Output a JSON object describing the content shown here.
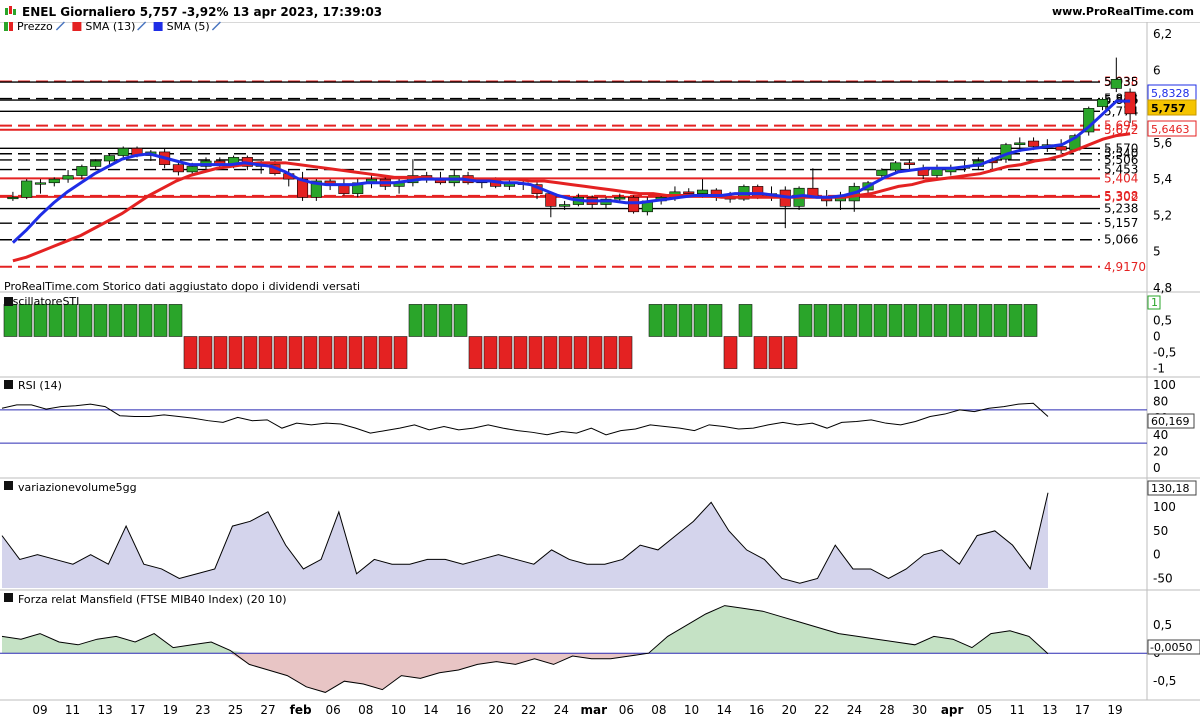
{
  "header": {
    "title": "ENEL Giornaliero 5,757 -3,92% 13 apr 2023, 17:39:03",
    "site": "www.ProRealTime.com"
  },
  "colors": {
    "up": "#2aa52a",
    "down": "#e42222",
    "sma13": "#e42222",
    "sma5": "#1e2de6",
    "level_red": "#e42222",
    "level_black": "#000000",
    "area_fill": "#d4d4ec",
    "mansfield_pos": "#c5e2c5",
    "mansfield_neg": "#e8c5c5"
  },
  "price_panel": {
    "legend": [
      {
        "icon": "price-candle-icon",
        "label": "Prezzo"
      },
      {
        "icon": "sma13-swatch-icon",
        "label": "SMA (13)"
      },
      {
        "icon": "sma5-swatch-icon",
        "label": "SMA (5)"
      }
    ],
    "note": "ProRealTime.com  Storico dati aggiustato dopo i dividendi versati",
    "y_ticks": [
      "6,2",
      "6",
      "5,8",
      "5,6",
      "5,4",
      "5,2",
      "5",
      "4,8"
    ],
    "price_tags": {
      "sma5": "5,8328",
      "last": "5,757",
      "sma13": "5,6463"
    },
    "levels": [
      {
        "value": 5.938,
        "label": "5,938",
        "color": "red",
        "style": "dashed"
      },
      {
        "value": 5.935,
        "label": "5,935",
        "color": "black",
        "style": "solid"
      },
      {
        "value": 5.844,
        "label": "5,844",
        "color": "black",
        "style": "dashed"
      },
      {
        "value": 5.836,
        "label": "5,836",
        "color": "black",
        "style": "solid"
      },
      {
        "value": 5.774,
        "label": "5,774",
        "color": "black",
        "style": "solid"
      },
      {
        "value": 5.695,
        "label": "5,695",
        "color": "red",
        "style": "dashed"
      },
      {
        "value": 5.672,
        "label": "5,672",
        "color": "red",
        "style": "solid"
      },
      {
        "value": 5.57,
        "label": "5,570",
        "color": "black",
        "style": "solid"
      },
      {
        "value": 5.54,
        "label": "5,540",
        "color": "black",
        "style": "dashed"
      },
      {
        "value": 5.506,
        "label": "5,506",
        "color": "black",
        "style": "dashed"
      },
      {
        "value": 5.453,
        "label": "5,453",
        "color": "black",
        "style": "dashed"
      },
      {
        "value": 5.404,
        "label": "5,404",
        "color": "red",
        "style": "solid"
      },
      {
        "value": 5.308,
        "label": "5,308",
        "color": "red",
        "style": "dashed"
      },
      {
        "value": 5.302,
        "label": "5,302",
        "color": "red",
        "style": "solid"
      },
      {
        "value": 5.238,
        "label": "5,238",
        "color": "black",
        "style": "solid"
      },
      {
        "value": 5.157,
        "label": "5,157",
        "color": "black",
        "style": "dashed"
      },
      {
        "value": 5.066,
        "label": "5,066",
        "color": "black",
        "style": "dashed"
      },
      {
        "value": 4.917,
        "label": "4,9170",
        "color": "red",
        "style": "dashed"
      }
    ]
  },
  "chart_data": {
    "type": "candlestick",
    "x_labels": [
      "09",
      "11",
      "13",
      "17",
      "19",
      "23",
      "25",
      "27",
      "feb",
      "06",
      "08",
      "10",
      "14",
      "16",
      "20",
      "22",
      "24",
      "mar",
      "06",
      "08",
      "10",
      "14",
      "16",
      "20",
      "22",
      "24",
      "28",
      "30",
      "apr",
      "05",
      "11",
      "13",
      "17",
      "19"
    ],
    "ylim": [
      4.8,
      6.2
    ],
    "candles": [
      [
        5.3,
        5.33,
        5.28,
        5.3
      ],
      [
        5.3,
        5.4,
        5.29,
        5.39
      ],
      [
        5.38,
        5.4,
        5.32,
        5.38
      ],
      [
        5.38,
        5.41,
        5.36,
        5.4
      ],
      [
        5.4,
        5.45,
        5.38,
        5.42
      ],
      [
        5.42,
        5.48,
        5.4,
        5.47
      ],
      [
        5.47,
        5.51,
        5.45,
        5.5
      ],
      [
        5.5,
        5.54,
        5.47,
        5.53
      ],
      [
        5.53,
        5.58,
        5.51,
        5.57
      ],
      [
        5.57,
        5.58,
        5.52,
        5.53
      ],
      [
        5.53,
        5.56,
        5.5,
        5.55
      ],
      [
        5.55,
        5.57,
        5.46,
        5.48
      ],
      [
        5.48,
        5.5,
        5.42,
        5.44
      ],
      [
        5.44,
        5.49,
        5.42,
        5.47
      ],
      [
        5.47,
        5.52,
        5.45,
        5.5
      ],
      [
        5.5,
        5.52,
        5.46,
        5.48
      ],
      [
        5.48,
        5.53,
        5.46,
        5.52
      ],
      [
        5.52,
        5.53,
        5.45,
        5.47
      ],
      [
        5.47,
        5.5,
        5.43,
        5.48
      ],
      [
        5.48,
        5.5,
        5.42,
        5.43
      ],
      [
        5.43,
        5.45,
        5.36,
        5.4
      ],
      [
        5.4,
        5.44,
        5.28,
        5.3
      ],
      [
        5.3,
        5.4,
        5.28,
        5.39
      ],
      [
        5.39,
        5.4,
        5.34,
        5.37
      ],
      [
        5.37,
        5.4,
        5.31,
        5.32
      ],
      [
        5.32,
        5.4,
        5.3,
        5.38
      ],
      [
        5.38,
        5.42,
        5.35,
        5.4
      ],
      [
        5.4,
        5.42,
        5.34,
        5.36
      ],
      [
        5.36,
        5.4,
        5.32,
        5.38
      ],
      [
        5.38,
        5.51,
        5.36,
        5.42
      ],
      [
        5.42,
        5.44,
        5.38,
        5.4
      ],
      [
        5.4,
        5.44,
        5.37,
        5.38
      ],
      [
        5.38,
        5.45,
        5.36,
        5.42
      ],
      [
        5.42,
        5.44,
        5.37,
        5.38
      ],
      [
        5.38,
        5.4,
        5.35,
        5.4
      ],
      [
        5.4,
        5.41,
        5.35,
        5.36
      ],
      [
        5.36,
        5.4,
        5.34,
        5.38
      ],
      [
        5.38,
        5.4,
        5.34,
        5.37
      ],
      [
        5.37,
        5.39,
        5.29,
        5.32
      ],
      [
        5.32,
        5.33,
        5.19,
        5.25
      ],
      [
        5.25,
        5.28,
        5.23,
        5.26
      ],
      [
        5.26,
        5.32,
        5.25,
        5.3
      ],
      [
        5.3,
        5.31,
        5.24,
        5.26
      ],
      [
        5.26,
        5.3,
        5.24,
        5.29
      ],
      [
        5.29,
        5.32,
        5.27,
        5.3
      ],
      [
        5.3,
        5.31,
        5.21,
        5.22
      ],
      [
        5.22,
        5.3,
        5.2,
        5.28
      ],
      [
        5.28,
        5.32,
        5.26,
        5.3
      ],
      [
        5.3,
        5.36,
        5.28,
        5.33
      ],
      [
        5.33,
        5.35,
        5.3,
        5.32
      ],
      [
        5.32,
        5.4,
        5.3,
        5.34
      ],
      [
        5.34,
        5.35,
        5.28,
        5.3
      ],
      [
        5.3,
        5.33,
        5.27,
        5.29
      ],
      [
        5.29,
        5.37,
        5.28,
        5.36
      ],
      [
        5.36,
        5.37,
        5.29,
        5.3
      ],
      [
        5.3,
        5.36,
        5.28,
        5.32
      ],
      [
        5.34,
        5.36,
        5.13,
        5.25
      ],
      [
        5.25,
        5.36,
        5.23,
        5.35
      ],
      [
        5.35,
        5.46,
        5.33,
        5.3
      ],
      [
        5.3,
        5.34,
        5.25,
        5.28
      ],
      [
        5.28,
        5.33,
        5.23,
        5.3
      ],
      [
        5.28,
        5.38,
        5.22,
        5.36
      ],
      [
        5.34,
        5.39,
        5.31,
        5.38
      ],
      [
        5.42,
        5.46,
        5.4,
        5.45
      ],
      [
        5.45,
        5.5,
        5.43,
        5.49
      ],
      [
        5.49,
        5.51,
        5.45,
        5.48
      ],
      [
        5.46,
        5.48,
        5.4,
        5.42
      ],
      [
        5.42,
        5.48,
        5.4,
        5.46
      ],
      [
        5.44,
        5.48,
        5.42,
        5.46
      ],
      [
        5.46,
        5.5,
        5.44,
        5.47
      ],
      [
        5.47,
        5.52,
        5.45,
        5.5
      ],
      [
        5.5,
        5.52,
        5.44,
        5.49
      ],
      [
        5.51,
        5.6,
        5.49,
        5.59
      ],
      [
        5.59,
        5.63,
        5.55,
        5.6
      ],
      [
        5.61,
        5.63,
        5.56,
        5.58
      ],
      [
        5.58,
        5.62,
        5.55,
        5.59
      ],
      [
        5.58,
        5.62,
        5.54,
        5.56
      ],
      [
        5.56,
        5.65,
        5.55,
        5.64
      ],
      [
        5.66,
        5.8,
        5.64,
        5.79
      ],
      [
        5.8,
        5.85,
        5.78,
        5.84
      ],
      [
        5.9,
        6.07,
        5.88,
        5.95
      ],
      [
        5.88,
        5.9,
        5.71,
        5.76
      ]
    ],
    "sma13": [
      4.95,
      4.97,
      5.0,
      5.03,
      5.06,
      5.09,
      5.13,
      5.17,
      5.21,
      5.26,
      5.31,
      5.35,
      5.39,
      5.42,
      5.44,
      5.46,
      5.47,
      5.48,
      5.49,
      5.49,
      5.49,
      5.48,
      5.47,
      5.46,
      5.45,
      5.44,
      5.43,
      5.42,
      5.41,
      5.41,
      5.41,
      5.4,
      5.4,
      5.4,
      5.4,
      5.4,
      5.4,
      5.4,
      5.39,
      5.39,
      5.38,
      5.37,
      5.36,
      5.35,
      5.34,
      5.33,
      5.32,
      5.32,
      5.31,
      5.31,
      5.31,
      5.31,
      5.3,
      5.3,
      5.3,
      5.3,
      5.3,
      5.3,
      5.3,
      5.3,
      5.3,
      5.3,
      5.31,
      5.32,
      5.34,
      5.36,
      5.37,
      5.39,
      5.4,
      5.41,
      5.42,
      5.43,
      5.45,
      5.47,
      5.48,
      5.5,
      5.51,
      5.53,
      5.56,
      5.59,
      5.62,
      5.64,
      5.65
    ],
    "sma5": [
      5.05,
      5.12,
      5.2,
      5.27,
      5.33,
      5.38,
      5.43,
      5.47,
      5.51,
      5.53,
      5.54,
      5.52,
      5.5,
      5.48,
      5.48,
      5.48,
      5.48,
      5.49,
      5.48,
      5.47,
      5.44,
      5.4,
      5.38,
      5.37,
      5.37,
      5.37,
      5.38,
      5.38,
      5.38,
      5.39,
      5.4,
      5.4,
      5.4,
      5.4,
      5.39,
      5.39,
      5.38,
      5.38,
      5.37,
      5.34,
      5.31,
      5.29,
      5.28,
      5.28,
      5.28,
      5.27,
      5.27,
      5.28,
      5.29,
      5.3,
      5.31,
      5.31,
      5.31,
      5.32,
      5.32,
      5.32,
      5.31,
      5.3,
      5.31,
      5.3,
      5.3,
      5.31,
      5.33,
      5.37,
      5.41,
      5.44,
      5.45,
      5.46,
      5.46,
      5.46,
      5.47,
      5.48,
      5.51,
      5.54,
      5.56,
      5.57,
      5.58,
      5.59,
      5.63,
      5.69,
      5.76,
      5.83,
      5.83
    ],
    "sti": {
      "title": "OscillatoreSTI",
      "y_ticks": [
        "0,5",
        "0",
        "-0,5",
        "-1"
      ],
      "tag": "1",
      "values": [
        1,
        1,
        1,
        1,
        1,
        1,
        1,
        1,
        1,
        1,
        1,
        1,
        -1,
        -1,
        -1,
        -1,
        -1,
        -1,
        -1,
        -1,
        -1,
        -1,
        -1,
        -1,
        -1,
        -1,
        -1,
        1,
        1,
        1,
        1,
        -1,
        -1,
        -1,
        -1,
        -1,
        -1,
        -1,
        -1,
        -1,
        -1,
        -1,
        0,
        1,
        1,
        1,
        1,
        1,
        -1,
        1,
        -1,
        -1,
        -1,
        1,
        1,
        1,
        1,
        1,
        1,
        1,
        1,
        1,
        1,
        1,
        1,
        1,
        1,
        1,
        1
      ]
    },
    "rsi": {
      "title": "RSI (14)",
      "y_ticks": [
        "100",
        "80",
        "60",
        "40",
        "20",
        "0"
      ],
      "bands": [
        70,
        30
      ],
      "tag": "60,169",
      "values": [
        72,
        76,
        76,
        71,
        74,
        75,
        77,
        74,
        63,
        62,
        62,
        64,
        62,
        60,
        57,
        55,
        61,
        57,
        58,
        48,
        54,
        52,
        54,
        53,
        48,
        42,
        45,
        48,
        52,
        46,
        50,
        46,
        48,
        52,
        48,
        45,
        43,
        40,
        44,
        42,
        48,
        40,
        45,
        47,
        52,
        50,
        48,
        45,
        52,
        50,
        47,
        48,
        52,
        55,
        52,
        54,
        48,
        55,
        56,
        58,
        54,
        52,
        56,
        62,
        65,
        70,
        68,
        72,
        74,
        77,
        78,
        62
      ]
    },
    "volume": {
      "title": "variazionevolume5gg",
      "y_ticks": [
        "100",
        "50",
        "0",
        "-50"
      ],
      "tag": "130,18",
      "values": [
        40,
        -10,
        0,
        -10,
        -20,
        0,
        -20,
        60,
        -20,
        -30,
        -50,
        -40,
        -30,
        60,
        70,
        90,
        20,
        -30,
        -10,
        90,
        -40,
        -10,
        -20,
        -20,
        -10,
        -10,
        -20,
        -10,
        0,
        -10,
        -20,
        10,
        -10,
        -20,
        -20,
        -10,
        20,
        10,
        40,
        70,
        110,
        50,
        10,
        -10,
        -50,
        -60,
        -50,
        20,
        -30,
        -30,
        -50,
        -30,
        0,
        10,
        -20,
        40,
        50,
        20,
        -30,
        130
      ]
    },
    "mansfield": {
      "title": "Forza relat Mansfield (FTSE MIB40 Index) (20 10)",
      "y_ticks": [
        "0,5",
        "0",
        "-0,5"
      ],
      "tag": "-0,0050",
      "values": [
        0.3,
        0.25,
        0.35,
        0.2,
        0.15,
        0.25,
        0.3,
        0.2,
        0.35,
        0.1,
        0.15,
        0.2,
        0.05,
        -0.2,
        -0.3,
        -0.4,
        -0.6,
        -0.7,
        -0.5,
        -0.55,
        -0.65,
        -0.4,
        -0.45,
        -0.35,
        -0.3,
        -0.2,
        -0.15,
        -0.2,
        -0.1,
        -0.2,
        -0.05,
        -0.1,
        -0.1,
        -0.05,
        0.0,
        0.3,
        0.5,
        0.7,
        0.85,
        0.8,
        0.75,
        0.65,
        0.55,
        0.45,
        0.35,
        0.3,
        0.25,
        0.2,
        0.15,
        0.3,
        0.25,
        0.1,
        0.35,
        0.4,
        0.3,
        -0.01
      ]
    }
  }
}
